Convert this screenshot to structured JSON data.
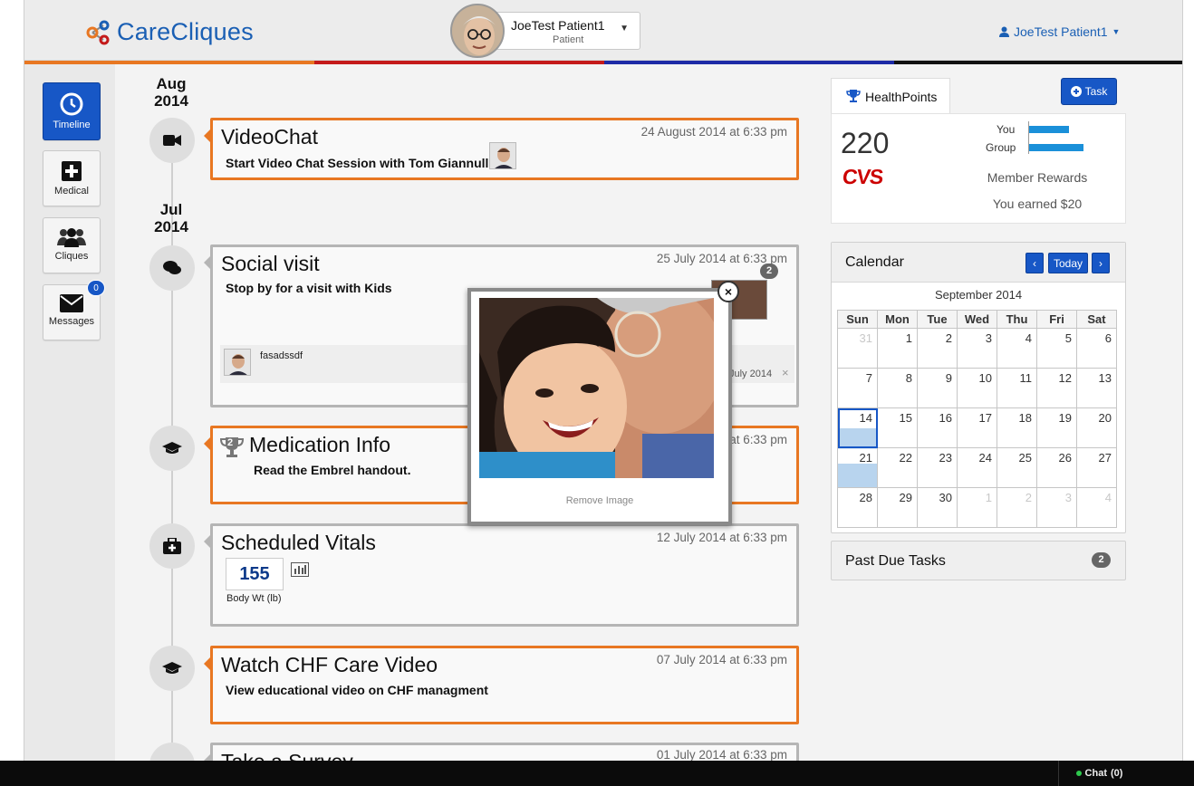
{
  "app": {
    "logo_text": "CareCliques",
    "brand_color": "#1a5fb4",
    "accent_colors": [
      "#e87722",
      "#c41a1a",
      "#1d2aa6",
      "#111111"
    ]
  },
  "header": {
    "patient": {
      "name": "JoeTest Patient1",
      "role": "Patient"
    },
    "user_menu": {
      "label": "JoeTest Patient1"
    }
  },
  "sidebar": {
    "items": [
      {
        "label": "Timeline",
        "icon": "clock-icon",
        "active": true
      },
      {
        "label": "Medical",
        "icon": "medical-plus-icon",
        "active": false
      },
      {
        "label": "Cliques",
        "icon": "people-icon",
        "active": false
      },
      {
        "label": "Messages",
        "icon": "envelope-icon",
        "active": false,
        "badge": "0"
      }
    ]
  },
  "timeline": {
    "dates": [
      {
        "month": "Aug",
        "year": "2014"
      },
      {
        "month": "Jul",
        "year": "2014"
      }
    ],
    "entries": [
      {
        "title": "VideoChat",
        "date": "24 August 2014 at 6:33 pm",
        "description": "Start Video Chat Session with Tom Giannulli",
        "icon": "video-camera-icon",
        "style": "orange"
      },
      {
        "title": "Social visit",
        "date": "25 July 2014 at 6:33 pm",
        "description": "Stop by for a visit with Kids",
        "icon": "chat-bubbles-icon",
        "style": "gray",
        "photo_count": "2",
        "comment": {
          "text": "fasadssdf",
          "date": "July 2014"
        }
      },
      {
        "title": "Medication Info",
        "date": "at 6:33 pm",
        "description": "Read the Embrel handout.",
        "icon": "graduation-cap-icon",
        "style": "orange",
        "trophy_count": "2"
      },
      {
        "title": "Scheduled Vitals",
        "date": "12 July 2014 at 6:33 pm",
        "icon": "medkit-icon",
        "style": "gray",
        "vital": {
          "value": "155",
          "label": "Body Wt (lb)"
        }
      },
      {
        "title": "Watch CHF Care Video",
        "date": "07 July 2014 at 6:33 pm",
        "description": "View educational video on CHF managment",
        "icon": "graduation-cap-icon",
        "style": "orange"
      },
      {
        "title": "Take a Survey",
        "date": "01 July 2014 at 6:33 pm",
        "icon": "survey-icon",
        "style": "gray"
      }
    ]
  },
  "healthpoints": {
    "tab_label": "HealthPoints",
    "task_button": "Task",
    "points": "220",
    "sponsor": "CVS",
    "bars": [
      {
        "label": "You",
        "fraction": 0.55
      },
      {
        "label": "Group",
        "fraction": 0.75
      }
    ],
    "rewards_title": "Member Rewards",
    "rewards_earned": "You earned $20"
  },
  "calendar": {
    "title": "Calendar",
    "today_button": "Today",
    "month_label": "September 2014",
    "weekdays": [
      "Sun",
      "Mon",
      "Tue",
      "Wed",
      "Thu",
      "Fri",
      "Sat"
    ],
    "weeks": [
      [
        "31",
        "1",
        "2",
        "3",
        "4",
        "5",
        "6"
      ],
      [
        "7",
        "8",
        "9",
        "10",
        "11",
        "12",
        "13"
      ],
      [
        "14",
        "15",
        "16",
        "17",
        "18",
        "19",
        "20"
      ],
      [
        "21",
        "22",
        "23",
        "24",
        "25",
        "26",
        "27"
      ],
      [
        "28",
        "29",
        "30",
        "1",
        "2",
        "3",
        "4"
      ]
    ],
    "today": "14",
    "selected": "21"
  },
  "past_due": {
    "title": "Past Due Tasks",
    "count": "2"
  },
  "popup": {
    "close_label": "×",
    "remove_label": "Remove Image"
  },
  "chat": {
    "label": "Chat",
    "count": "(0)"
  }
}
